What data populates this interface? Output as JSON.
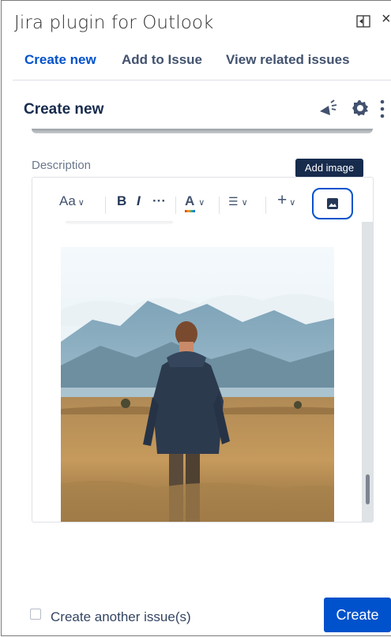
{
  "window": {
    "title": "Jira plugin for Outlook",
    "close_glyph": "×"
  },
  "nav": {
    "tabs": [
      {
        "label": "Create new",
        "active": true
      },
      {
        "label": "Add to Issue",
        "active": false
      },
      {
        "label": "View related issues",
        "active": false
      }
    ]
  },
  "panel": {
    "title": "Create new"
  },
  "description": {
    "label": "Description"
  },
  "toolbar": {
    "text_style": "Aa",
    "bold": "B",
    "italic": "I",
    "more": "···",
    "text_color": "A",
    "list": "☰",
    "insert": "+",
    "tooltip": "Add image"
  },
  "footer": {
    "checkbox_label": "Create another issue(s)",
    "checkbox_checked": false,
    "create_label": "Create"
  },
  "colors": {
    "accent": "#0052cc",
    "text": "#172b4d"
  }
}
